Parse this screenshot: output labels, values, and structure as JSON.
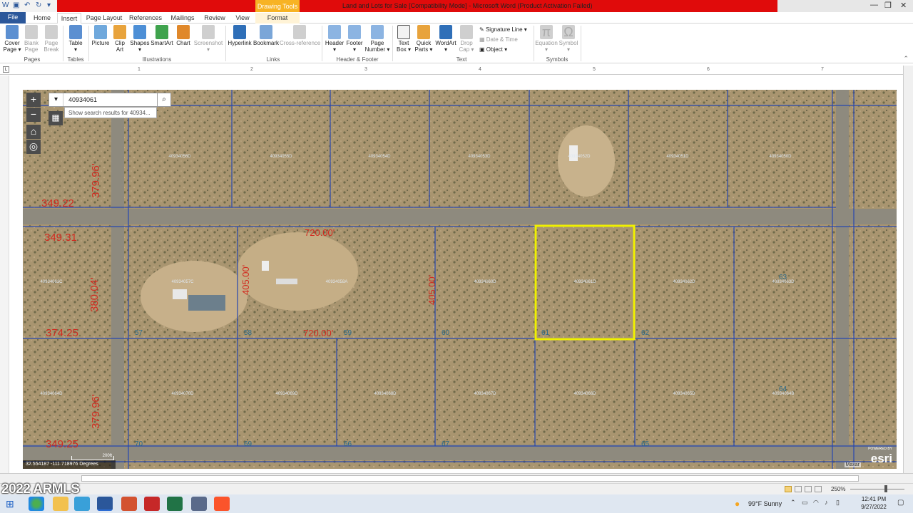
{
  "window": {
    "title": "Land and Lots for Sale [Compatibility Mode] - Microsoft Word (Product Activation Failed)",
    "context_tab_group": "Drawing Tools",
    "controls": [
      "—",
      "❐",
      "✕"
    ]
  },
  "tabs": [
    {
      "label": "File"
    },
    {
      "label": "Home"
    },
    {
      "label": "Insert"
    },
    {
      "label": "Page Layout"
    },
    {
      "label": "References"
    },
    {
      "label": "Mailings"
    },
    {
      "label": "Review"
    },
    {
      "label": "View"
    },
    {
      "label": "Format"
    }
  ],
  "ribbon": {
    "buttons": [
      {
        "label": "Cover\nPage ▾",
        "icon": "cover-page-icon",
        "color": "#5b8fd1"
      },
      {
        "label": "Blank\nPage",
        "icon": "blank-page-icon",
        "color": "#cfcfcf"
      },
      {
        "label": "Page\nBreak",
        "icon": "page-break-icon",
        "color": "#cfcfcf"
      },
      {
        "label": "Table\n▾",
        "icon": "table-icon",
        "color": "#5b8fd1"
      },
      {
        "label": "Picture",
        "icon": "picture-icon",
        "color": "#6fa8dc"
      },
      {
        "label": "Clip\nArt",
        "icon": "clip-art-icon",
        "color": "#e8a33c"
      },
      {
        "label": "Shapes\n▾",
        "icon": "shapes-icon",
        "color": "#4d8fd6"
      },
      {
        "label": "SmartArt",
        "icon": "smartart-icon",
        "color": "#3fa34d"
      },
      {
        "label": "Chart",
        "icon": "chart-icon",
        "color": "#e0882a"
      },
      {
        "label": "Screenshot\n▾",
        "icon": "screenshot-icon",
        "color": "#cfcfcf"
      },
      {
        "label": "Hyperlink",
        "icon": "hyperlink-icon",
        "color": "#2f6fb8"
      },
      {
        "label": "Bookmark",
        "icon": "bookmark-icon",
        "color": "#7aa6d8"
      },
      {
        "label": "Cross-reference",
        "icon": "cross-reference-icon",
        "color": "#cfcfcf"
      },
      {
        "label": "Header\n▾",
        "icon": "header-icon",
        "color": "#8cb4e2"
      },
      {
        "label": "Footer\n▾",
        "icon": "footer-icon",
        "color": "#8cb4e2"
      },
      {
        "label": "Page\nNumber ▾",
        "icon": "page-number-icon",
        "color": "#8cb4e2"
      },
      {
        "label": "Text\nBox ▾",
        "icon": "text-box-icon",
        "color": "#f2f2f2"
      },
      {
        "label": "Quick\nParts ▾",
        "icon": "quick-parts-icon",
        "color": "#e8a33c"
      },
      {
        "label": "WordArt\n▾",
        "icon": "wordart-icon",
        "color": "#2f6fb8"
      },
      {
        "label": "Drop\nCap ▾",
        "icon": "drop-cap-icon",
        "color": "#cfcfcf"
      },
      {
        "label": "Equation\n▾",
        "icon": "equation-icon",
        "color": "#cfcfcf"
      },
      {
        "label": "Symbol\n▾",
        "icon": "symbol-icon",
        "color": "#cfcfcf"
      }
    ],
    "text_small": {
      "signature_line": "Signature Line ▾",
      "date_time": "Date & Time",
      "object": "Object ▾"
    },
    "groups": [
      "Pages",
      "Tables",
      "Illustrations",
      "Links",
      "Header & Footer",
      "Text",
      "Symbols"
    ]
  },
  "ruler": {
    "numbers": [
      "1",
      "2",
      "3",
      "4",
      "5",
      "6",
      "7"
    ]
  },
  "map": {
    "search_value": "40934061",
    "search_suggestion": "Show search results for 40934...",
    "coordinates": "32.554187  -111.718976 Degrees",
    "scale_label": "200ft",
    "attribution": "Maxar",
    "esri_powered": "POWERED BY",
    "esri_logo": "esri",
    "parcels_top": [
      "40934056D",
      "40934055D",
      "40934054D",
      "40934053D",
      "40934052D",
      "40934051D",
      "40934050D"
    ],
    "parcels_mid": [
      "40934063C",
      "40934057C",
      "40934058A",
      "40934060D",
      "40934061D",
      "40934062D",
      "40934063D"
    ],
    "parcels_bot": [
      "40934064D",
      "40934070D",
      "40934069D",
      "40934068D",
      "40934067D",
      "40934066D",
      "40934065D",
      "40934064B"
    ],
    "dims": {
      "d1": "349.22",
      "d2": "349.31",
      "d3": "374.25",
      "d4": "349.25",
      "d5": "720.00'",
      "d6": "720.00'",
      "v1": "379.96'",
      "v2": "380.04'",
      "v3": "379.96'",
      "v4": "405.00'",
      "v5": "405.00'"
    },
    "lot_numbers": [
      "57",
      "58",
      "59",
      "60",
      "61",
      "62",
      "63",
      "70",
      "69",
      "66",
      "67",
      "65",
      "64"
    ],
    "selected_parcel": "40934061D",
    "highlight_color": "#f0f000"
  },
  "status": {
    "zoom": "250%",
    "watermark": "2022 ARMLS"
  },
  "taskbar": {
    "weather": "99°F  Sunny",
    "time": "12:41 PM",
    "date": "9/27/2022"
  }
}
